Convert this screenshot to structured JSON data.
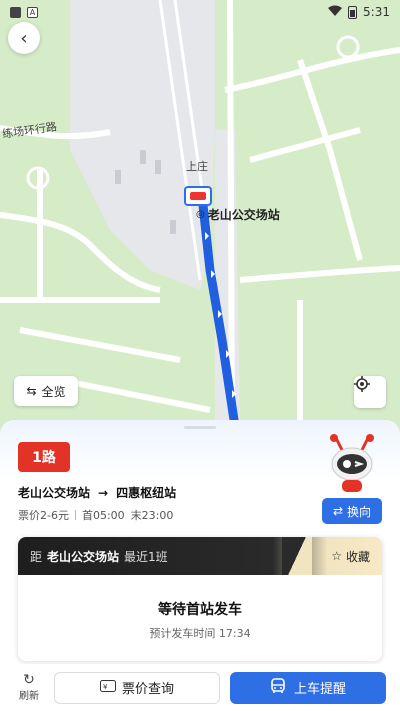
{
  "status_bar": {
    "time": "5:31",
    "a_icon": "A"
  },
  "map": {
    "road_label": "练场环行路",
    "road_label_2": "上庄",
    "station": "老山公交场站",
    "overview_label": "全览",
    "icons": {
      "back": "back-arrow-icon",
      "overview": "swap-arrows-icon",
      "locate": "crosshair-icon"
    }
  },
  "route": {
    "number": "1路",
    "from": "老山公交场站",
    "to": "四惠枢纽站",
    "arrow": "→",
    "fare": "票价2-6元",
    "first": "首05:00",
    "last": "末23:00",
    "reverse_label": "换向"
  },
  "card": {
    "prefix": "距",
    "stop": "老山公交场站",
    "info": "最近1班",
    "favorite_label": "收藏",
    "wait_title": "等待首站发车",
    "wait_sub": "预计发车时间  17:34"
  },
  "bottom": {
    "refresh_label": "刷新",
    "fare_query_label": "票价查询",
    "remind_label": "上车提醒"
  },
  "colors": {
    "accent": "#2f6fe6",
    "route_badge": "#e33326",
    "map_green": "#d6ecc9"
  }
}
